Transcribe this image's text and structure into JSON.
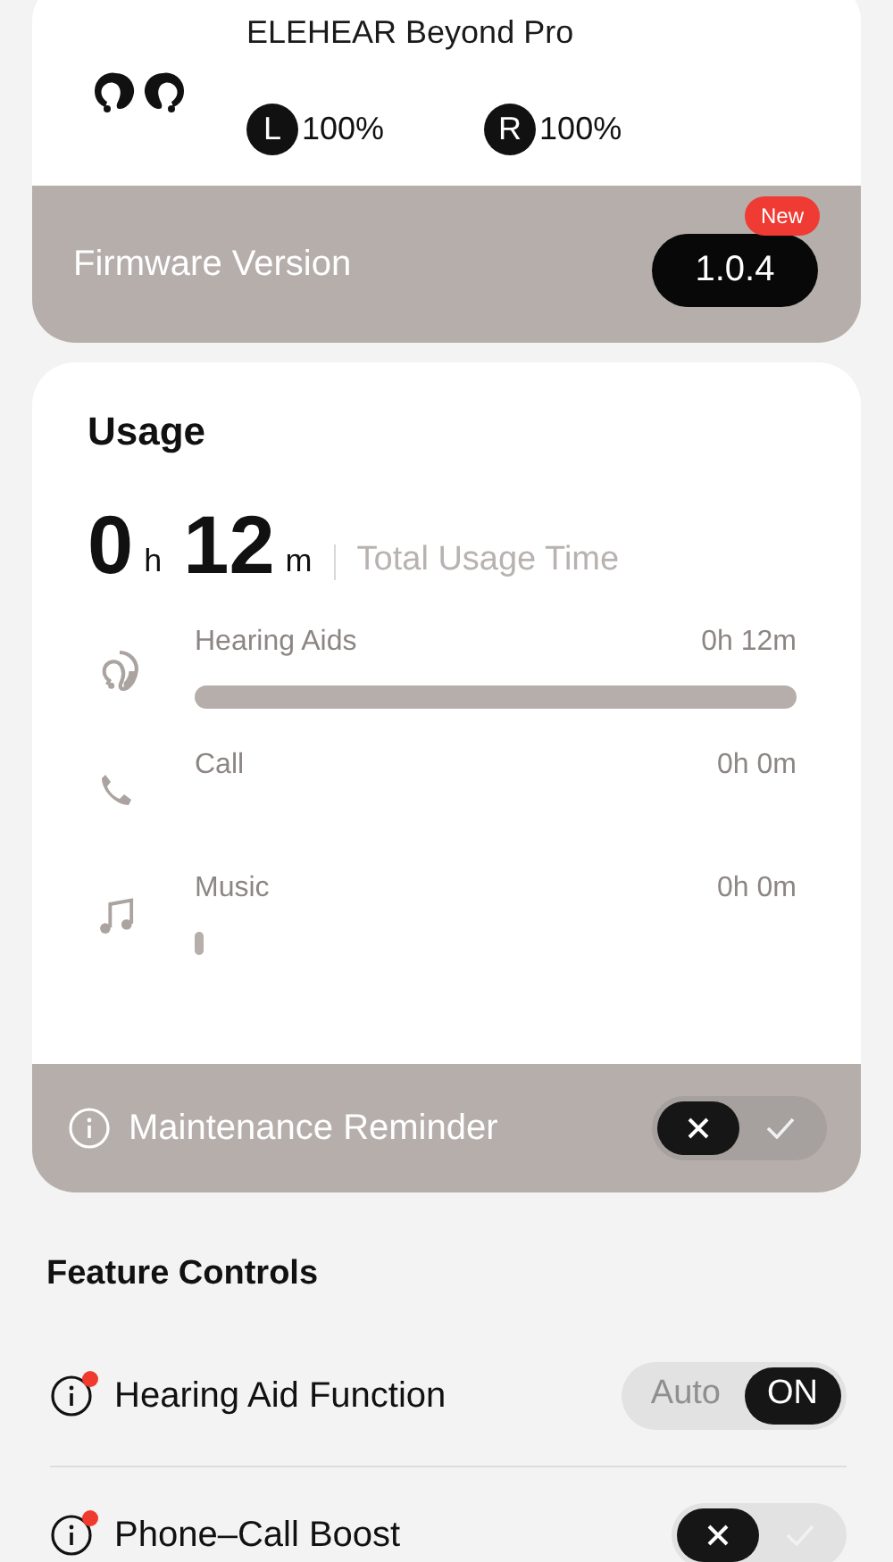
{
  "device": {
    "name": "ELEHEAR Beyond Pro",
    "batteries": [
      {
        "side": "L",
        "reading": "100%"
      },
      {
        "side": "R",
        "reading": "100%"
      }
    ]
  },
  "firmware": {
    "label": "Firmware Version",
    "version": "1.0.4",
    "badge": "New"
  },
  "usage": {
    "title": "Usage",
    "hours": "0",
    "hours_unit": "h",
    "minutes": "12",
    "minutes_unit": "m",
    "caption": "Total Usage Time",
    "items": [
      {
        "kind": "hearing",
        "label": "Hearing Aids",
        "time": "0h 12m"
      },
      {
        "kind": "call",
        "label": "Call",
        "time": "0h 0m"
      },
      {
        "kind": "music",
        "label": "Music",
        "time": "0h 0m"
      }
    ],
    "reminder": {
      "label": "Maintenance Reminder",
      "on": false
    }
  },
  "feature_controls": {
    "title": "Feature Controls",
    "items": [
      {
        "kind": "mode",
        "label": "Hearing Aid Function",
        "alert": true,
        "options": [
          {
            "label": "Auto",
            "selected": false
          },
          {
            "label": "ON",
            "selected": true
          }
        ]
      },
      {
        "kind": "switch",
        "label": "Phone–Call Boost",
        "alert": true,
        "on": false
      }
    ]
  }
}
